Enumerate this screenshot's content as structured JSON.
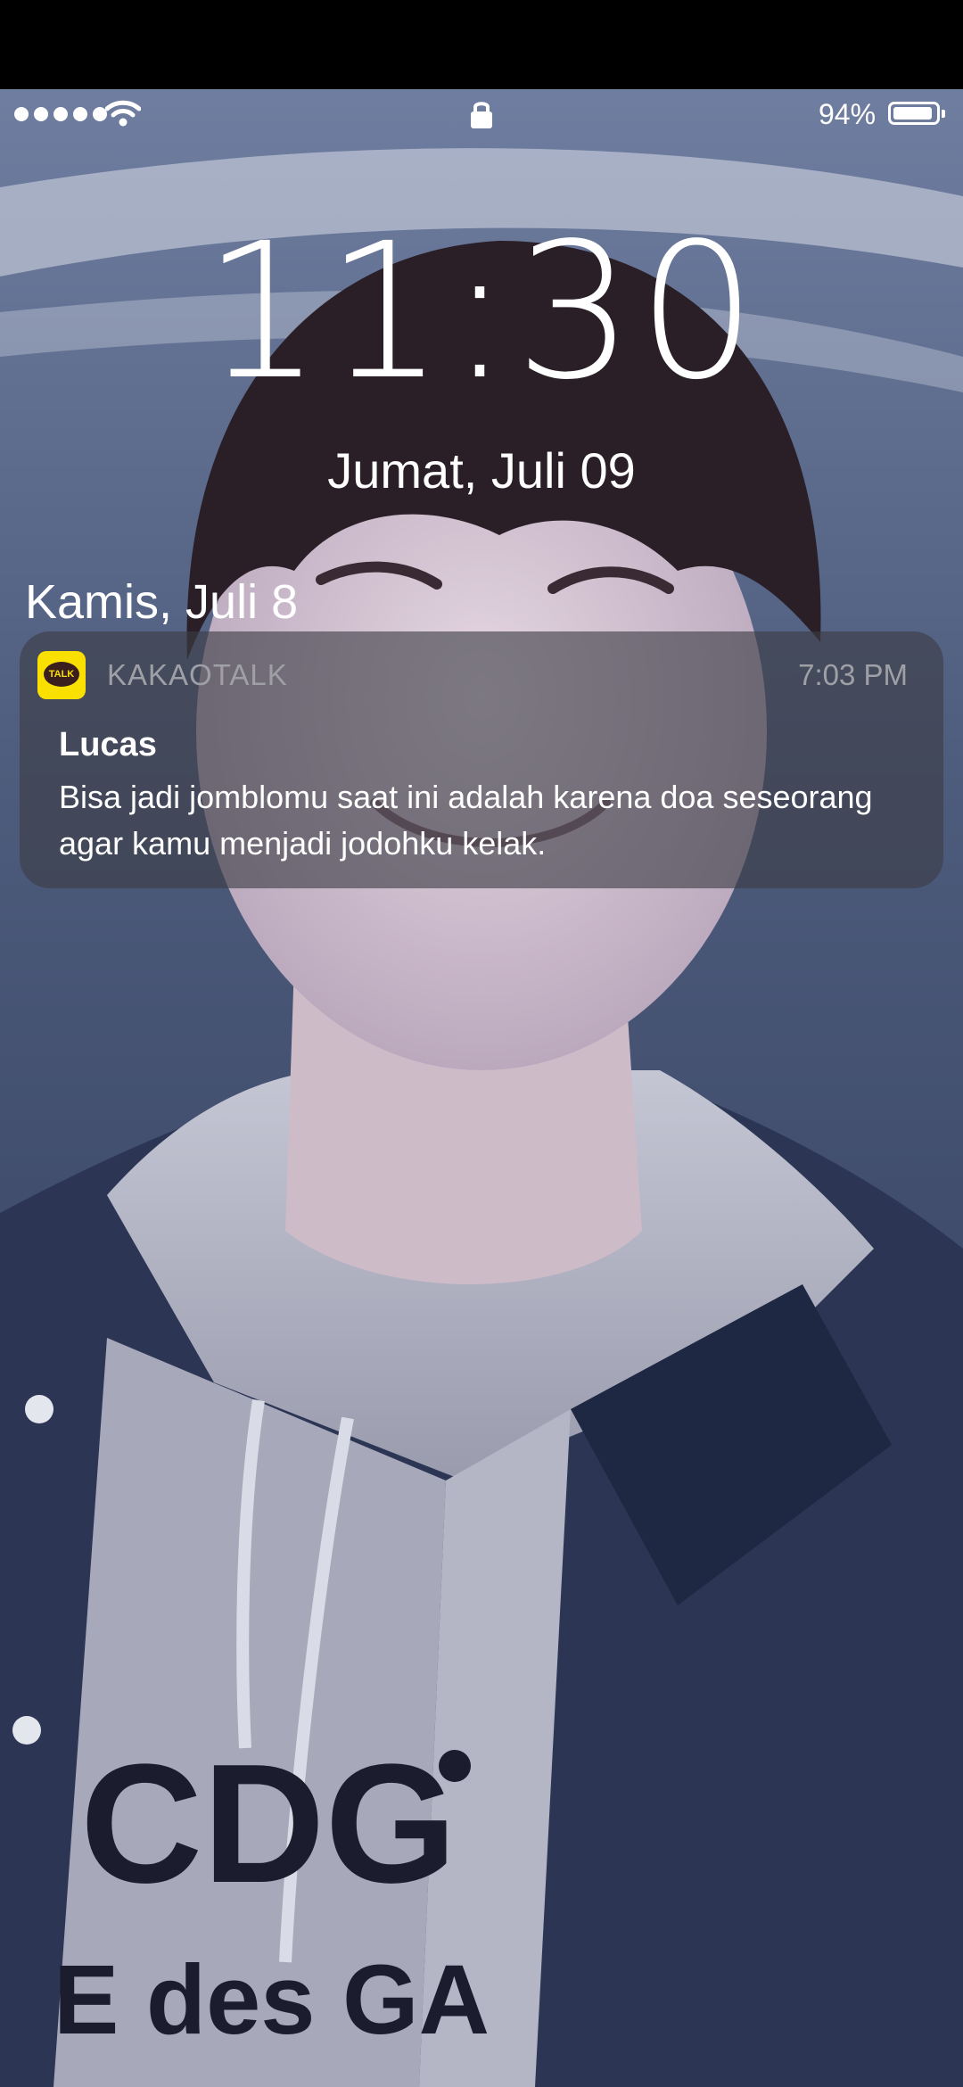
{
  "status_bar": {
    "signal_dots": 5,
    "battery_percent": "94%",
    "battery_level": 0.94
  },
  "lock_screen": {
    "time": "11:30",
    "date": "Jumat, Juli 09"
  },
  "notifications": {
    "section_date": "Kamis, Juli 8",
    "items": [
      {
        "app_icon_label": "TALK",
        "app_name": "KAKAOTALK",
        "time": "7:03 PM",
        "title": "Lucas",
        "body": "Bisa jadi jomblomu saat ini adalah karena doa seseorang agar kamu menjadi jodohku kelak."
      }
    ]
  },
  "wallpaper": {
    "description_icon": "photo-wallpaper",
    "sweatshirt_print": "CDG",
    "sweatshirt_print_line2": "E des GA"
  },
  "colors": {
    "kakao_yellow": "#f9e000",
    "kakao_brown": "#3b1e1e",
    "notification_bg": "rgba(60,62,70,0.62)"
  }
}
